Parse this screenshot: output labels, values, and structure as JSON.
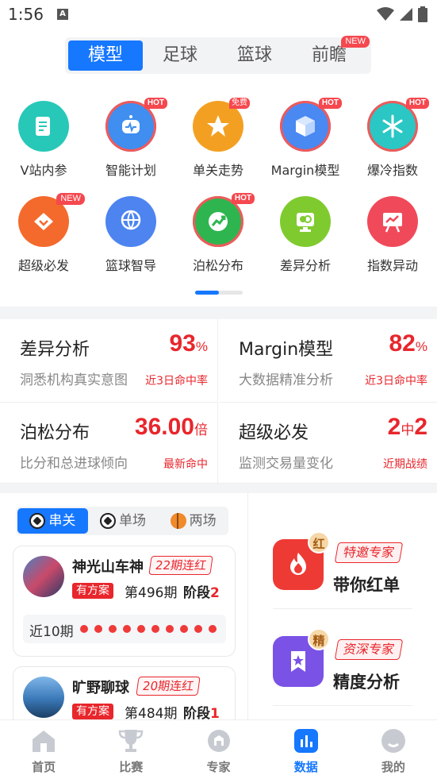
{
  "status_bar": {
    "time": "1:56",
    "indicator": "A"
  },
  "top_tabs": [
    {
      "label": "模型",
      "active": true
    },
    {
      "label": "足球",
      "active": false
    },
    {
      "label": "篮球",
      "active": false
    },
    {
      "label": "前瞻",
      "active": false,
      "badge": "NEW"
    }
  ],
  "grid": [
    {
      "label": "V站内参",
      "color": "#27c8b8",
      "icon": "document-icon"
    },
    {
      "label": "智能计划",
      "color": "#3f8ef0",
      "icon": "robot-icon",
      "tag": "HOT"
    },
    {
      "label": "单关走势",
      "color": "#f3a022",
      "icon": "star-icon",
      "tag": "免费"
    },
    {
      "label": "Margin模型",
      "color": "#4a88f2",
      "icon": "cube-icon",
      "tag": "HOT"
    },
    {
      "label": "爆冷指数",
      "color": "#2ac7c4",
      "icon": "snowflake-icon",
      "tag": "HOT"
    },
    {
      "label": "超级必发",
      "color": "#f46a2c",
      "icon": "diamond-icon",
      "tag": "NEW"
    },
    {
      "label": "篮球智导",
      "color": "#4d84f0",
      "icon": "basketball-icon"
    },
    {
      "label": "泊松分布",
      "color": "#2fb54f",
      "icon": "trend-up-icon",
      "tag": "HOT"
    },
    {
      "label": "差异分析",
      "color": "#7fcb2f",
      "icon": "compare-icon"
    },
    {
      "label": "指数异动",
      "color": "#f04a5a",
      "icon": "chart-board-icon"
    }
  ],
  "stats": [
    {
      "title": "差异分析",
      "value": "93",
      "unit": "%",
      "desc": "洞悉机构真实意图",
      "note": "近3日命中率"
    },
    {
      "title": "Margin模型",
      "value": "82",
      "unit": "%",
      "desc": "大数据精准分析",
      "note": "近3日命中率"
    },
    {
      "title": "泊松分布",
      "value": "36.00",
      "unit": "倍",
      "desc": "比分和总进球倾向",
      "note": "最新命中"
    },
    {
      "title": "超级必发",
      "value": "2",
      "unit": "中",
      "value2": "2",
      "desc": "监测交易量变化",
      "note": "近期战绩"
    }
  ],
  "segments": [
    {
      "label": "串关",
      "active": true
    },
    {
      "label": "单场",
      "active": false
    },
    {
      "label": "两场",
      "active": false
    }
  ],
  "experts": [
    {
      "name": "神光山车神",
      "streak": "22期连红",
      "plan": "有方案",
      "issue": "第496期",
      "stage_label": "阶段",
      "stage_value": "2",
      "recent_label": "近10期",
      "recent_count": 10
    },
    {
      "name": "旷野聊球",
      "streak": "20期连红",
      "plan": "有方案",
      "issue": "第484期",
      "stage_label": "阶段",
      "stage_value": "1"
    }
  ],
  "promos": [
    {
      "badge": "红",
      "tag": "特邀专家",
      "title": "带你红单",
      "color": "#ee3a35"
    },
    {
      "badge": "精",
      "tag": "资深专家",
      "title": "精度分析",
      "color": "#7b52e6"
    }
  ],
  "nav": [
    {
      "label": "首页",
      "icon": "home-icon",
      "active": false
    },
    {
      "label": "比赛",
      "icon": "trophy-icon",
      "active": false
    },
    {
      "label": "专家",
      "icon": "expert-icon",
      "active": false
    },
    {
      "label": "数据",
      "icon": "data-icon",
      "active": true
    },
    {
      "label": "我的",
      "icon": "profile-icon",
      "active": false
    }
  ]
}
